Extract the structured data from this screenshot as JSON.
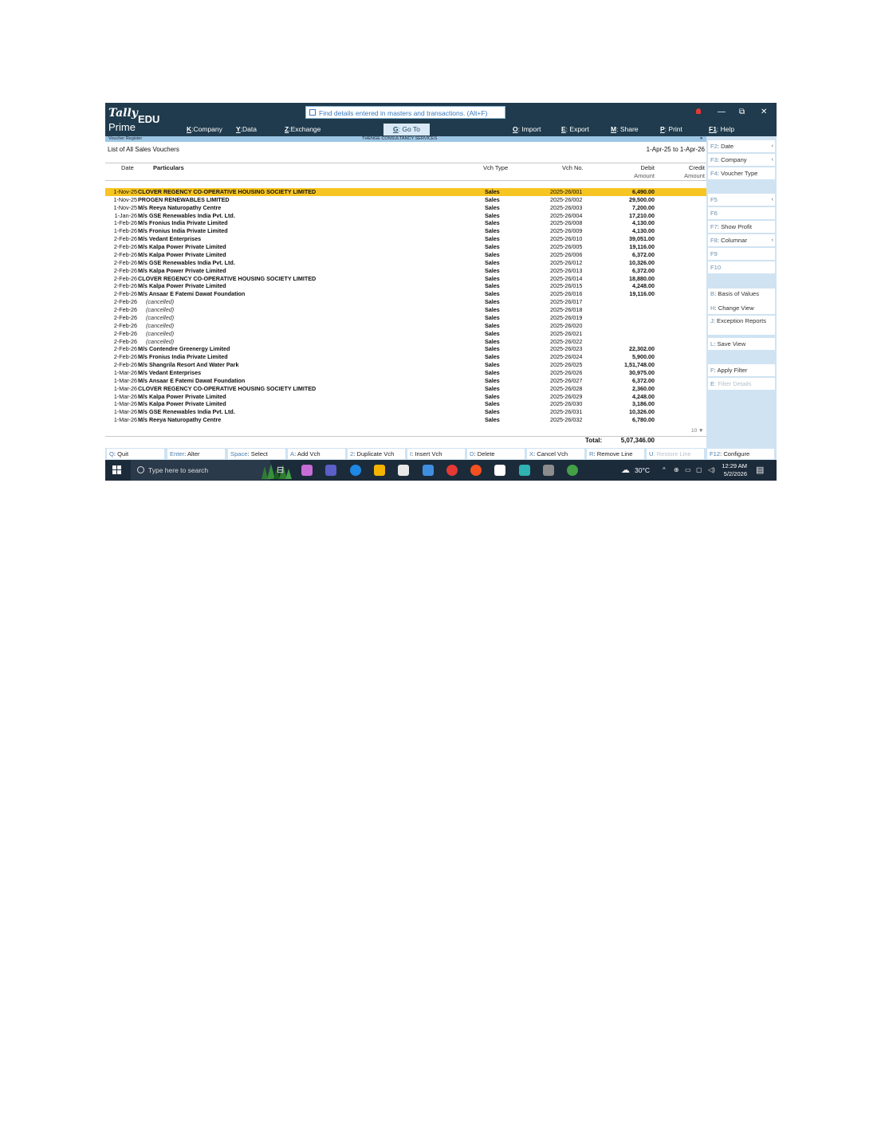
{
  "app": {
    "logo_top": "Tally",
    "logo_edu": "EDU",
    "logo_bottom": "Prime",
    "search_placeholder": "Find details entered in masters and transactions. (Alt+F)",
    "menu": [
      {
        "key": "K",
        "label": ":Company"
      },
      {
        "key": "Y",
        "label": ":Data"
      },
      {
        "key": "Z",
        "label": ":Exchange"
      },
      {
        "key": "G",
        "label": ": Go To"
      },
      {
        "key": "O",
        "label": ": Import"
      },
      {
        "key": "E",
        "label": ": Export"
      },
      {
        "key": "M",
        "label": ": Share"
      },
      {
        "key": "P",
        "label": ": Print"
      },
      {
        "key": "F1",
        "label": ": Help"
      }
    ],
    "window_controls": {
      "minimize": "—",
      "restore": "⧉",
      "close": "✕"
    }
  },
  "report": {
    "screen_name": "Voucher Register",
    "company": "THENGE CONSULTANCY SERVICES",
    "close_glyph": "×",
    "subtitle": "List of All Sales Vouchers",
    "period": "1-Apr-25 to 1-Apr-26",
    "headers": {
      "date": "Date",
      "particulars": "Particulars",
      "vch_type": "Vch Type",
      "vch_no": "Vch No.",
      "debit_1": "Debit",
      "debit_2": "Amount",
      "credit_1": "Credit",
      "credit_2": "Amount"
    },
    "rows": [
      {
        "date": "1-Nov-25",
        "particulars": "CLOVER REGENCY CO-OPERATIVE HOUSING SOCIETY LIMITED",
        "type": "Sales",
        "no": "2025-26/001",
        "debit": "6,490.00"
      },
      {
        "date": "1-Nov-25",
        "particulars": "PROGEN RENEWABLES LIMITED",
        "type": "Sales",
        "no": "2025-26/002",
        "debit": "29,500.00"
      },
      {
        "date": "1-Nov-25",
        "particulars": "M/s Reeya Naturopathy Centre",
        "type": "Sales",
        "no": "2025-26/003",
        "debit": "7,200.00"
      },
      {
        "date": "1-Jan-26",
        "particulars": "M/s GSE Renewables India Pvt. Ltd.",
        "type": "Sales",
        "no": "2025-26/004",
        "debit": "17,210.00"
      },
      {
        "date": "1-Feb-26",
        "particulars": "M/s Fronius India Private Limited",
        "type": "Sales",
        "no": "2025-26/008",
        "debit": "4,130.00"
      },
      {
        "date": "1-Feb-26",
        "particulars": "M/s Fronius India Private Limited",
        "type": "Sales",
        "no": "2025-26/009",
        "debit": "4,130.00"
      },
      {
        "date": "2-Feb-26",
        "particulars": "M/s Vedant Enterprises",
        "type": "Sales",
        "no": "2025-26/010",
        "debit": "39,051.00"
      },
      {
        "date": "2-Feb-26",
        "particulars": "M/s Kalpa Power Private Limited",
        "type": "Sales",
        "no": "2025-26/005",
        "debit": "19,116.00"
      },
      {
        "date": "2-Feb-26",
        "particulars": "M/s Kalpa Power Private Limited",
        "type": "Sales",
        "no": "2025-26/006",
        "debit": "6,372.00"
      },
      {
        "date": "2-Feb-26",
        "particulars": "M/s GSE Renewables India Pvt. Ltd.",
        "type": "Sales",
        "no": "2025-26/012",
        "debit": "10,326.00"
      },
      {
        "date": "2-Feb-26",
        "particulars": "M/s Kalpa Power Private Limited",
        "type": "Sales",
        "no": "2025-26/013",
        "debit": "6,372.00"
      },
      {
        "date": "2-Feb-26",
        "particulars": "CLOVER REGENCY CO-OPERATIVE HOUSING SOCIETY LIMITED",
        "type": "Sales",
        "no": "2025-26/014",
        "debit": "18,880.00"
      },
      {
        "date": "2-Feb-26",
        "particulars": "M/s Kalpa Power Private Limited",
        "type": "Sales",
        "no": "2025-26/015",
        "debit": "4,248.00"
      },
      {
        "date": "2-Feb-26",
        "particulars": "M/s Ansaar E Fatemi Dawat Foundation",
        "type": "Sales",
        "no": "2025-26/016",
        "debit": "19,116.00"
      },
      {
        "date": "2-Feb-26",
        "particulars": "(cancelled)",
        "type": "Sales",
        "no": "2025-26/017",
        "debit": ""
      },
      {
        "date": "2-Feb-26",
        "particulars": "(cancelled)",
        "type": "Sales",
        "no": "2025-26/018",
        "debit": ""
      },
      {
        "date": "2-Feb-26",
        "particulars": "(cancelled)",
        "type": "Sales",
        "no": "2025-26/019",
        "debit": ""
      },
      {
        "date": "2-Feb-26",
        "particulars": "(cancelled)",
        "type": "Sales",
        "no": "2025-26/020",
        "debit": ""
      },
      {
        "date": "2-Feb-26",
        "particulars": "(cancelled)",
        "type": "Sales",
        "no": "2025-26/021",
        "debit": ""
      },
      {
        "date": "2-Feb-26",
        "particulars": "(cancelled)",
        "type": "Sales",
        "no": "2025-26/022",
        "debit": ""
      },
      {
        "date": "2-Feb-26",
        "particulars": "M/s Contendre Greenergy Limited",
        "type": "Sales",
        "no": "2025-26/023",
        "debit": "22,302.00"
      },
      {
        "date": "2-Feb-26",
        "particulars": "M/s Fronius India Private Limited",
        "type": "Sales",
        "no": "2025-26/024",
        "debit": "5,900.00"
      },
      {
        "date": "2-Feb-26",
        "particulars": "M/s Shangrila Resort And Water Park",
        "type": "Sales",
        "no": "2025-26/025",
        "debit": "1,51,748.00"
      },
      {
        "date": "1-Mar-26",
        "particulars": "M/s Vedant Enterprises",
        "type": "Sales",
        "no": "2025-26/026",
        "debit": "30,975.00"
      },
      {
        "date": "1-Mar-26",
        "particulars": "M/s Ansaar E Fatemi Dawat Foundation",
        "type": "Sales",
        "no": "2025-26/027",
        "debit": "6,372.00"
      },
      {
        "date": "1-Mar-26",
        "particulars": "CLOVER REGENCY CO-OPERATIVE HOUSING SOCIETY LIMITED",
        "type": "Sales",
        "no": "2025-26/028",
        "debit": "2,360.00"
      },
      {
        "date": "1-Mar-26",
        "particulars": "M/s Kalpa Power Private Limited",
        "type": "Sales",
        "no": "2025-26/029",
        "debit": "4,248.00"
      },
      {
        "date": "1-Mar-26",
        "particulars": "M/s Kalpa Power Private Limited",
        "type": "Sales",
        "no": "2025-26/030",
        "debit": "3,186.00"
      },
      {
        "date": "1-Mar-26",
        "particulars": "M/s GSE Renewables India Pvt. Ltd.",
        "type": "Sales",
        "no": "2025-26/031",
        "debit": "10,326.00"
      },
      {
        "date": "1-Mar-26",
        "particulars": "M/s Reeya Naturopathy Centre",
        "type": "Sales",
        "no": "2025-26/032",
        "debit": "6,780.00"
      }
    ],
    "page_indicator": "10 ▼",
    "total_label": "Total:",
    "total_value": "5,07,346.00"
  },
  "right_panel": [
    {
      "key": "F2",
      "label": ": Date",
      "dim": false,
      "arrow": "‹"
    },
    {
      "key": "F3",
      "label": ": Company",
      "dim": false,
      "arrow": "‹"
    },
    {
      "key": "F4",
      "label": ": Voucher Type",
      "dim": false,
      "arrow": ""
    },
    {
      "key": "F5",
      "label": "",
      "dim": true,
      "arrow": "‹"
    },
    {
      "key": "F6",
      "label": "",
      "dim": true,
      "arrow": ""
    },
    {
      "key": "F7",
      "label": ": Show Profit",
      "dim": false,
      "arrow": ""
    },
    {
      "key": "F8",
      "label": ": Columnar",
      "dim": false,
      "arrow": "‹"
    },
    {
      "key": "F9",
      "label": "",
      "dim": true,
      "arrow": ""
    },
    {
      "key": "F10",
      "label": "",
      "dim": true,
      "arrow": ""
    },
    {
      "key": "B",
      "label": ": Basis of Values",
      "dim": false,
      "arrow": ""
    },
    {
      "key": "H",
      "label": ": Change View",
      "dim": false,
      "arrow": ""
    },
    {
      "key": "J",
      "label": ": Exception Reports",
      "dim": false,
      "arrow": ""
    },
    {
      "key": "L",
      "label": ": Save View",
      "dim": false,
      "arrow": ""
    },
    {
      "key": "F",
      "label": ": Apply Filter",
      "dim": false,
      "arrow": ""
    },
    {
      "key": "E",
      "label": ": Filter Details",
      "dim": true,
      "arrow": ""
    }
  ],
  "bottom_bar": [
    {
      "key": "Q",
      "label": ": Quit",
      "dim": false
    },
    {
      "key": "Enter",
      "label": ": Alter",
      "dim": false
    },
    {
      "key": "Space",
      "label": ": Select",
      "dim": false
    },
    {
      "key": "A",
      "label": ": Add Vch",
      "dim": false
    },
    {
      "key": "2",
      "label": ": Duplicate Vch",
      "dim": false
    },
    {
      "key": "I",
      "label": ": Insert Vch",
      "dim": false
    },
    {
      "key": "D",
      "label": ": Delete",
      "dim": false
    },
    {
      "key": "X",
      "label": ": Cancel Vch",
      "dim": false
    },
    {
      "key": "R",
      "label": ": Remove Line",
      "dim": false
    },
    {
      "key": "U",
      "label": ": Restore Line",
      "dim": true
    },
    {
      "key": "F12",
      "label": ": Configure",
      "dim": false
    }
  ],
  "taskbar": {
    "search_placeholder": "Type here to search",
    "temperature": "30°C",
    "time": "12:29 AM",
    "date": "5/2/2026",
    "apps": [
      "copilot-icon",
      "teams-icon",
      "edge-icon",
      "file-explorer-icon",
      "store-icon",
      "mail-icon",
      "chrome-icon",
      "chrome-alt-icon",
      "tasks-icon",
      "tally-icon",
      "search-app-icon",
      "chrome-profile-icon"
    ],
    "app_colors": [
      "#c86dd7",
      "#5b5fc7",
      "#1e88e5",
      "#f4b400",
      "#e8e8e8",
      "#3f8fe0",
      "#e53935",
      "#f4511e",
      "#ffffff",
      "#2fb3b3",
      "#8c8c8c",
      "#43a047"
    ]
  }
}
